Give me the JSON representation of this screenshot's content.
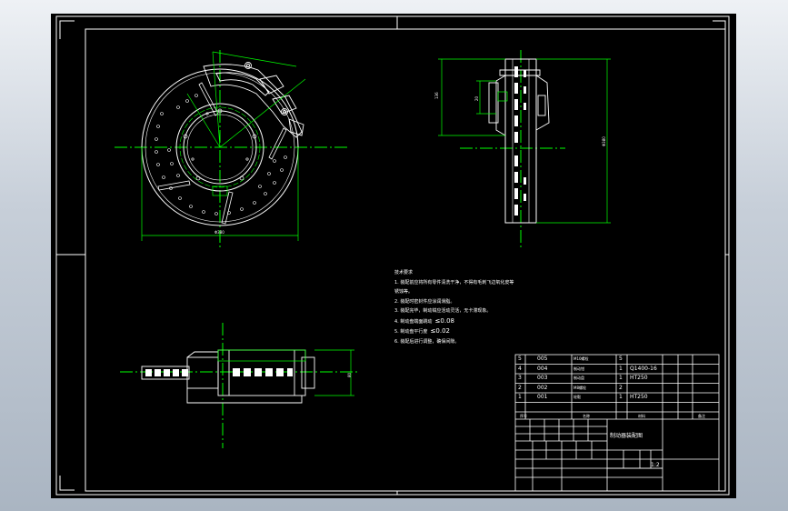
{
  "viewport": {
    "background": "#000000",
    "frame_color": "#ffffff",
    "center_line_color": "#00ff00",
    "dimension_color": "#00ff00",
    "geometry_color": "#ffffff"
  },
  "dims": {
    "front_width": "Φ380",
    "side_height": "Φ380",
    "side_left": "136",
    "side_inner": "20",
    "plan_height": "80"
  },
  "notes": {
    "title": "技术要求",
    "lines": [
      "1. 装配前应将所有零件清洗干净，不得有毛刺飞边氧化皮等",
      "锈蚀等。",
      "2. 装配时密封件应涂润滑脂。",
      "3. 装配完毕，制动钳应活动灵活，无卡滞现象。",
      "4. 制动盘端面跳动",
      "5. 制动盘平行度",
      "6. 装配后进行调整，确保间隙。"
    ],
    "tol_1": "≤0.08",
    "tol_2": "≤0.02"
  },
  "bom": {
    "rows": [
      {
        "no": "5",
        "code": "005",
        "name": "M10螺栓",
        "qty": "5",
        "material": ""
      },
      {
        "no": "4",
        "code": "004",
        "name": "制动钳",
        "qty": "1",
        "material": "Q1400-16"
      },
      {
        "no": "3",
        "code": "003",
        "name": "制动盘",
        "qty": "1",
        "material": "HT250"
      },
      {
        "no": "2",
        "code": "002",
        "name": "M8螺栓",
        "qty": "2",
        "material": ""
      },
      {
        "no": "1",
        "code": "001",
        "name": "轮毂",
        "qty": "1",
        "material": "HT250"
      }
    ],
    "header": {
      "no": "序号",
      "name": "名称",
      "material": "材料",
      "note": "备注"
    }
  },
  "title_block": {
    "drawing_title": "制动器装配图",
    "scale": "1:2"
  }
}
